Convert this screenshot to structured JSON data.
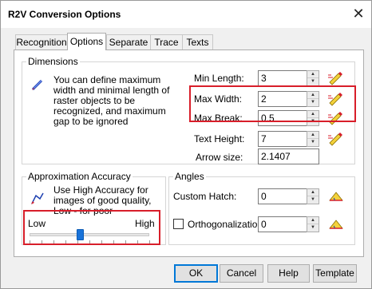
{
  "window": {
    "title": "R2V Conversion Options",
    "close_glyph": "✕"
  },
  "tabs": [
    {
      "label": "Recognition",
      "active": false
    },
    {
      "label": "Options",
      "active": true
    },
    {
      "label": "Separate",
      "active": false
    },
    {
      "label": "Trace",
      "active": false
    },
    {
      "label": "Texts",
      "active": false
    }
  ],
  "dimensions": {
    "group_label": "Dimensions",
    "description": "You can define maximum width and minimal length of raster objects to be recognized, and maximum gap to be ignored",
    "fields": {
      "min_length": {
        "label": "Min Length:",
        "value": "3"
      },
      "max_width": {
        "label": "Max Width:",
        "value": "2"
      },
      "max_break": {
        "label": "Max Break:",
        "value": "0.5"
      },
      "text_height": {
        "label": "Text Height:",
        "value": "7"
      },
      "arrow_size": {
        "label": "Arrow size:",
        "value": "2.1407"
      }
    }
  },
  "approximation": {
    "group_label": "Approximation Accuracy",
    "description": "Use High Accuracy  for images of good quality, Low - for poor",
    "low_label": "Low",
    "high_label": "High",
    "slider_level": 0.42
  },
  "angles": {
    "group_label": "Angles",
    "custom_hatch": {
      "label": "Custom Hatch:",
      "value": "0"
    },
    "orthogonalization": {
      "label": "Orthogonalization",
      "value": "0",
      "checked": false
    }
  },
  "buttons": {
    "ok": "OK",
    "cancel": "Cancel",
    "help": "Help",
    "template": "Template"
  },
  "colors": {
    "highlight": "#d81e2a",
    "slider_thumb": "#1a73d9",
    "default_button_border": "#0078d7"
  },
  "icons": {
    "measure_tool": "measure-pencil-icon",
    "angle_tool": "angle-tool-icon",
    "line_tool": "line-pencil-icon",
    "curve_tool": "curve-pencil-icon"
  }
}
